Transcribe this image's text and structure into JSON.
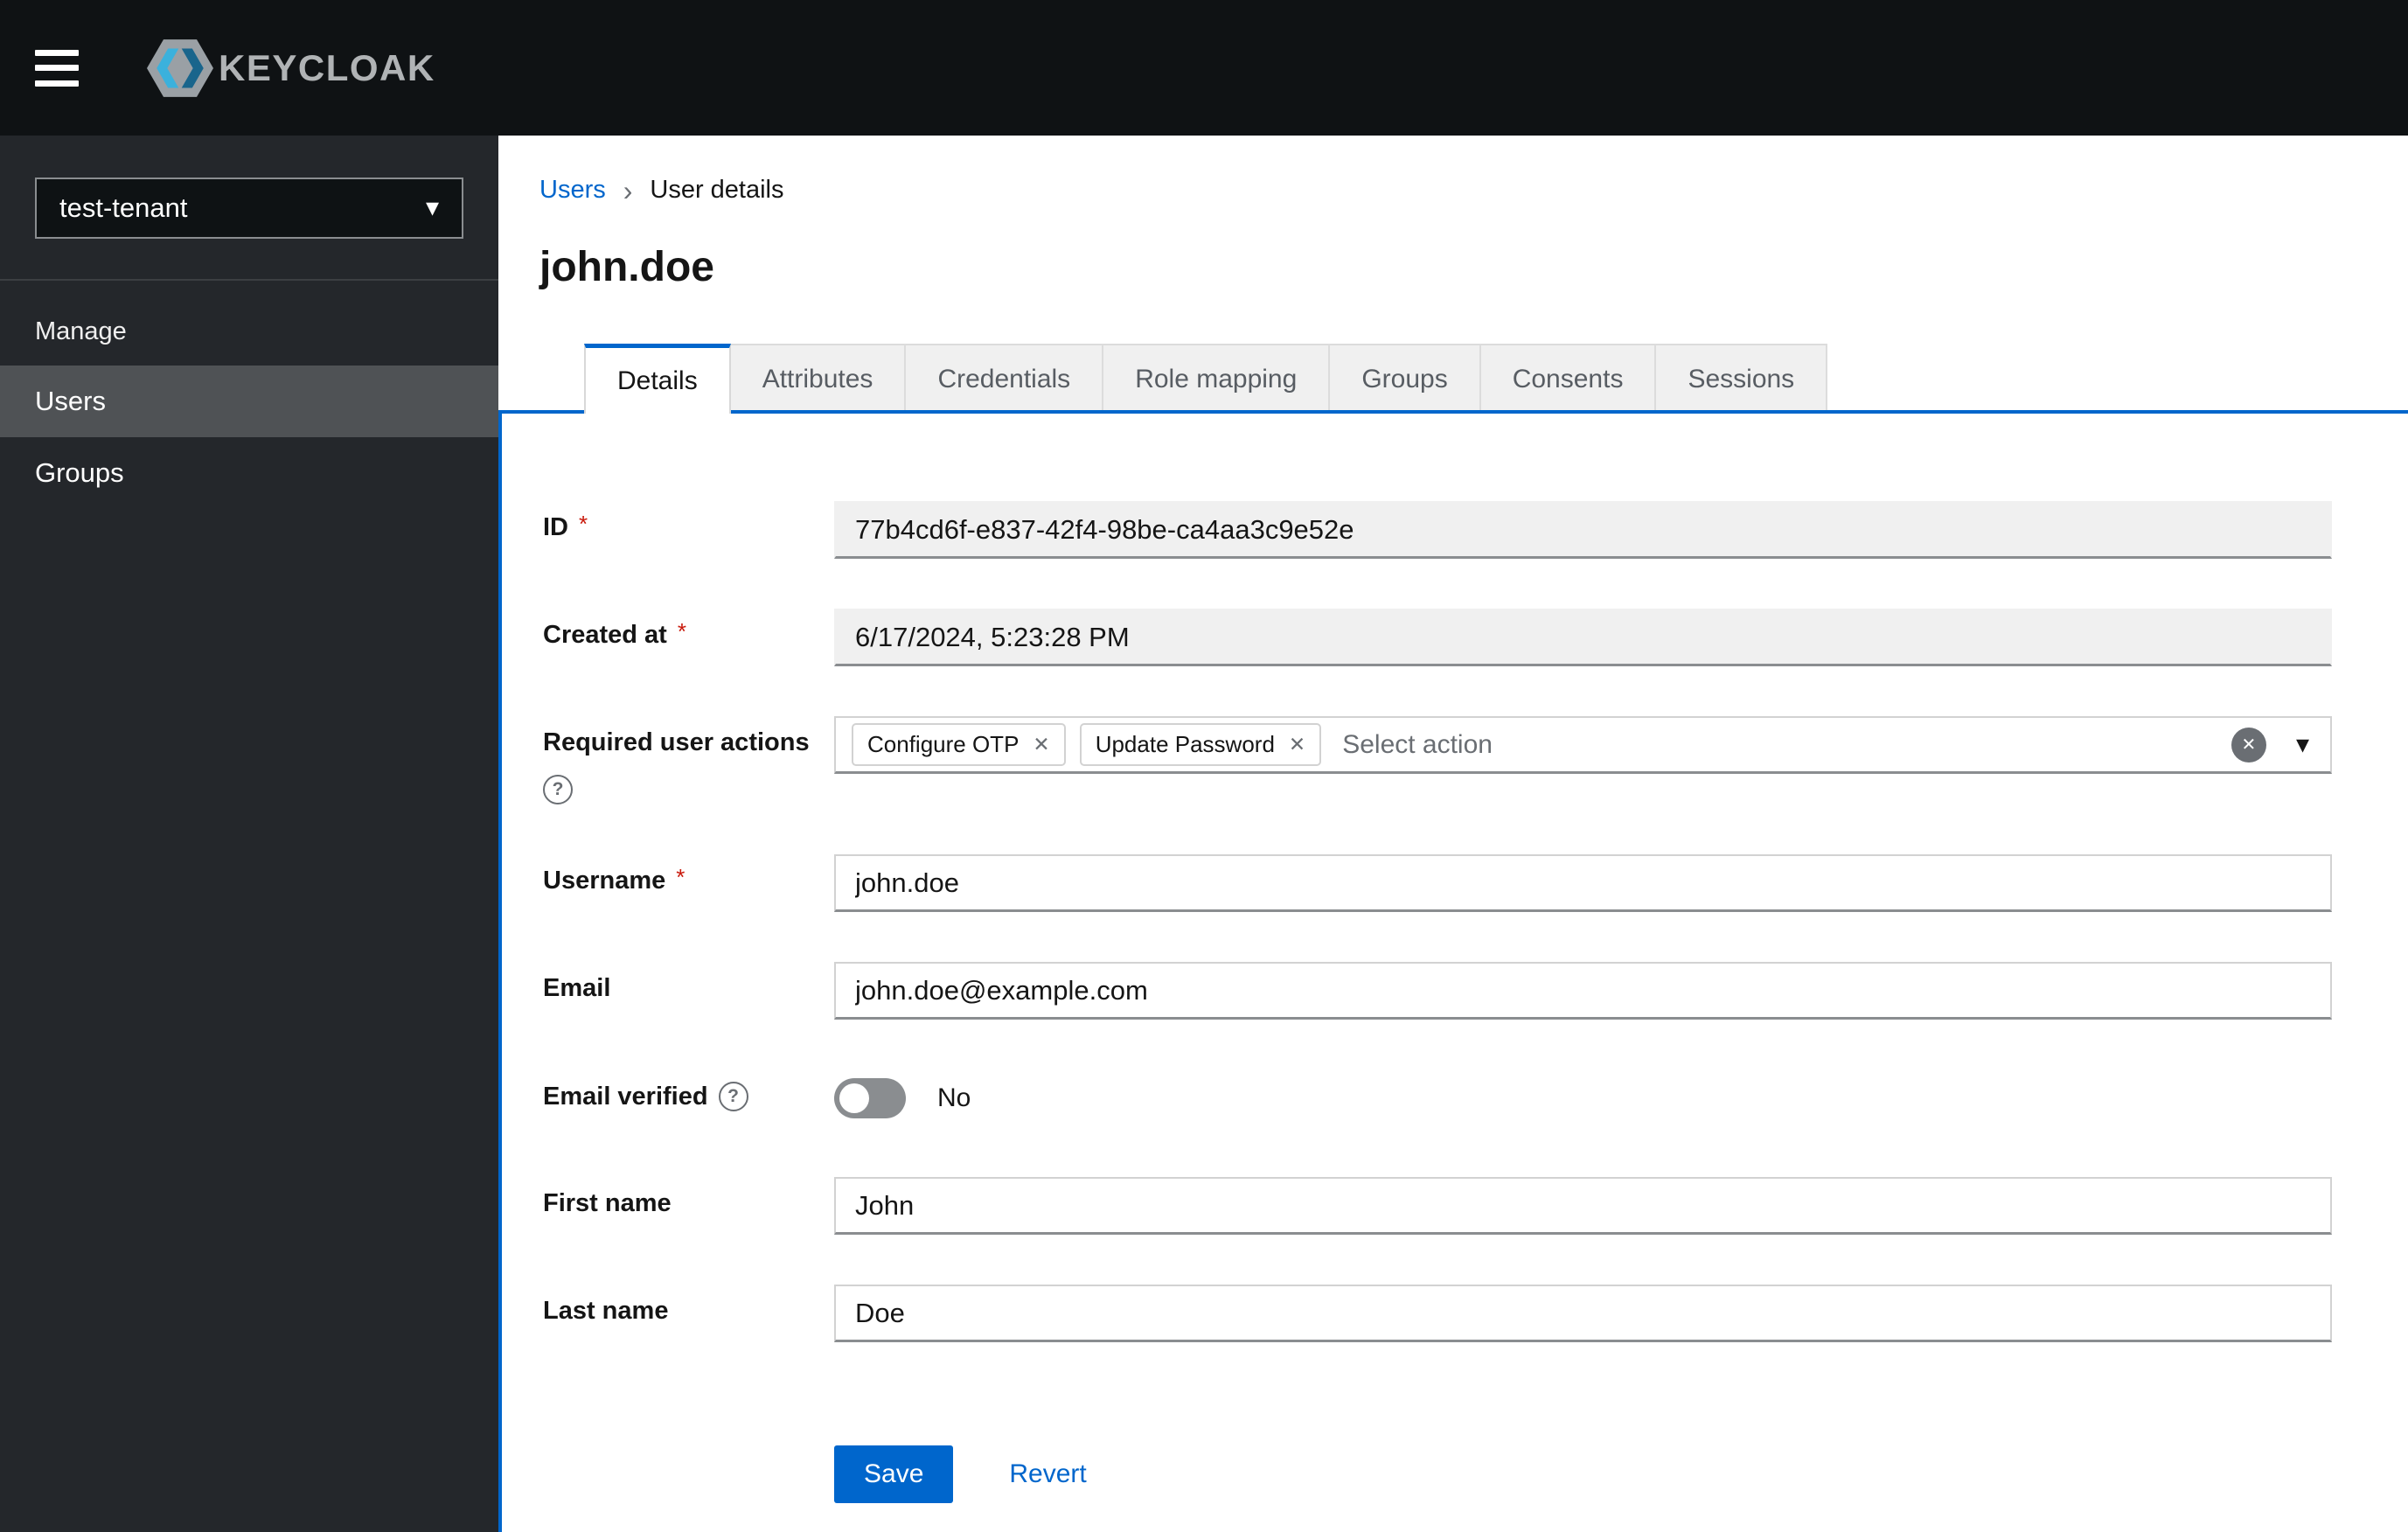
{
  "header": {
    "brand": "KEYCLOAK"
  },
  "sidebar": {
    "realm_selector": "test-tenant",
    "section_label": "Manage",
    "items": [
      {
        "label": "Users"
      },
      {
        "label": "Groups"
      }
    ]
  },
  "breadcrumb": {
    "items": [
      "Users",
      "User details"
    ]
  },
  "page": {
    "title": "john.doe"
  },
  "tabs": [
    {
      "label": "Details"
    },
    {
      "label": "Attributes"
    },
    {
      "label": "Credentials"
    },
    {
      "label": "Role mapping"
    },
    {
      "label": "Groups"
    },
    {
      "label": "Consents"
    },
    {
      "label": "Sessions"
    }
  ],
  "form": {
    "required_marker": "*",
    "id": {
      "label": "ID",
      "value": "77b4cd6f-e837-42f4-98be-ca4aa3c9e52e"
    },
    "created_at": {
      "label": "Created at",
      "value": "6/17/2024, 5:23:28 PM"
    },
    "required_user_actions": {
      "label": "Required user actions",
      "chips": [
        "Configure OTP",
        "Update Password"
      ],
      "placeholder": "Select action"
    },
    "username": {
      "label": "Username",
      "value": "john.doe"
    },
    "email": {
      "label": "Email",
      "value": "john.doe@example.com"
    },
    "email_verified": {
      "label": "Email verified",
      "state": "No"
    },
    "first_name": {
      "label": "First name",
      "value": "John"
    },
    "last_name": {
      "label": "Last name",
      "value": "Doe"
    }
  },
  "actions": {
    "save": "Save",
    "revert": "Revert"
  },
  "icons": {
    "help": "?",
    "breadcrumb_separator": "›",
    "clear": "✕",
    "chip_remove": "✕",
    "caret_down": "▾"
  },
  "colors": {
    "accent": "#0066cc",
    "danger": "#c9190b"
  }
}
